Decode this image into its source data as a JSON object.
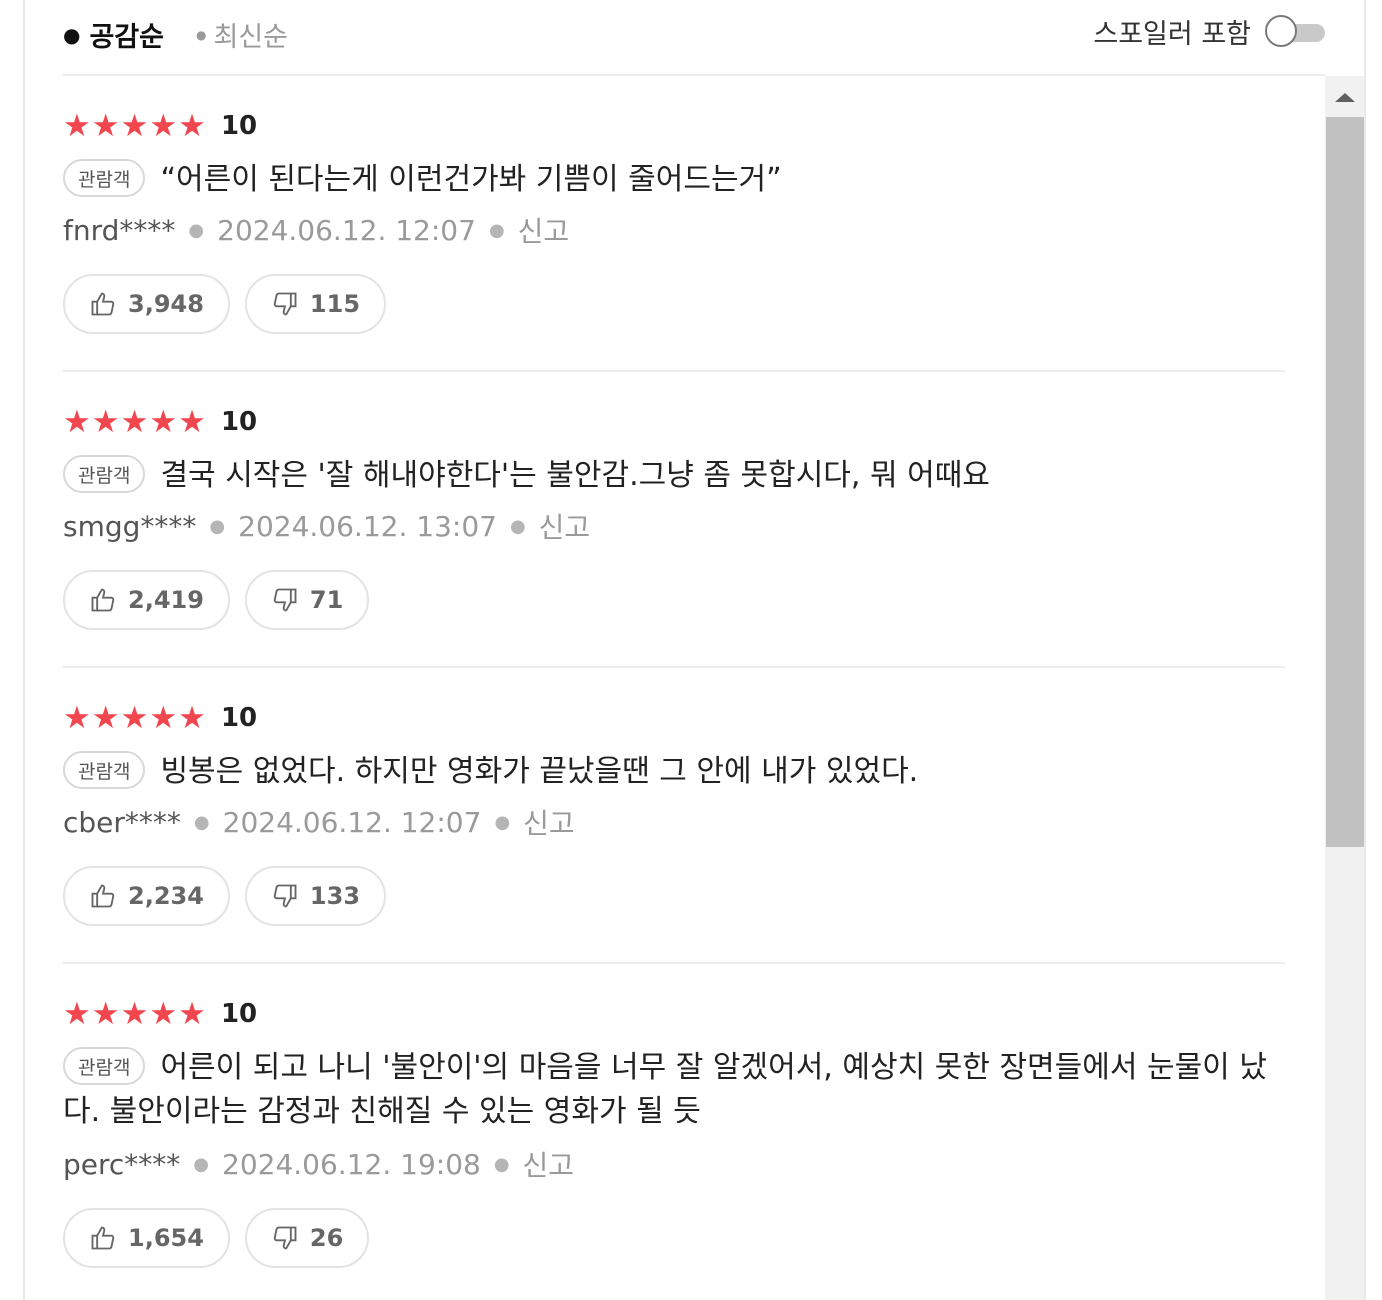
{
  "sort": {
    "active": "공감순",
    "inactive": "최신순"
  },
  "spoiler": {
    "label": "스포일러 포함",
    "enabled": false
  },
  "reviews": [
    {
      "stars": "★★★★★",
      "score": "10",
      "badge": "관람객",
      "text": "“어른이 된다는게 이런건가봐 기쁨이 줄어드는거”",
      "user": "fnrd****",
      "date": "2024.06.12. 12:07",
      "report": "신고",
      "likes": "3,948",
      "dislikes": "115"
    },
    {
      "stars": "★★★★★",
      "score": "10",
      "badge": "관람객",
      "text": "결국 시작은 '잘 해내야한다'는 불안감.그냥 좀 못합시다, 뭐 어때요",
      "user": "smgg****",
      "date": "2024.06.12. 13:07",
      "report": "신고",
      "likes": "2,419",
      "dislikes": "71"
    },
    {
      "stars": "★★★★★",
      "score": "10",
      "badge": "관람객",
      "text": "빙봉은 없었다. 하지만 영화가 끝났을땐 그 안에 내가 있었다.",
      "user": "cber****",
      "date": "2024.06.12. 12:07",
      "report": "신고",
      "likes": "2,234",
      "dislikes": "133"
    },
    {
      "stars": "★★★★★",
      "score": "10",
      "badge": "관람객",
      "text": "어른이 되고 나니 '불안이'의 마음을 너무 잘 알겠어서, 예상치 못한 장면들에서 눈물이 났다. 불안이라는 감정과 친해질 수 있는 영화가 될 듯",
      "user": "perc****",
      "date": "2024.06.12. 19:08",
      "report": "신고",
      "likes": "1,654",
      "dislikes": "26"
    }
  ],
  "icons": {
    "like": "thumbs-up-icon",
    "dislike": "thumbs-down-icon",
    "scroll_up": "triangle-up-icon"
  },
  "colors": {
    "star": "#f1464e"
  }
}
